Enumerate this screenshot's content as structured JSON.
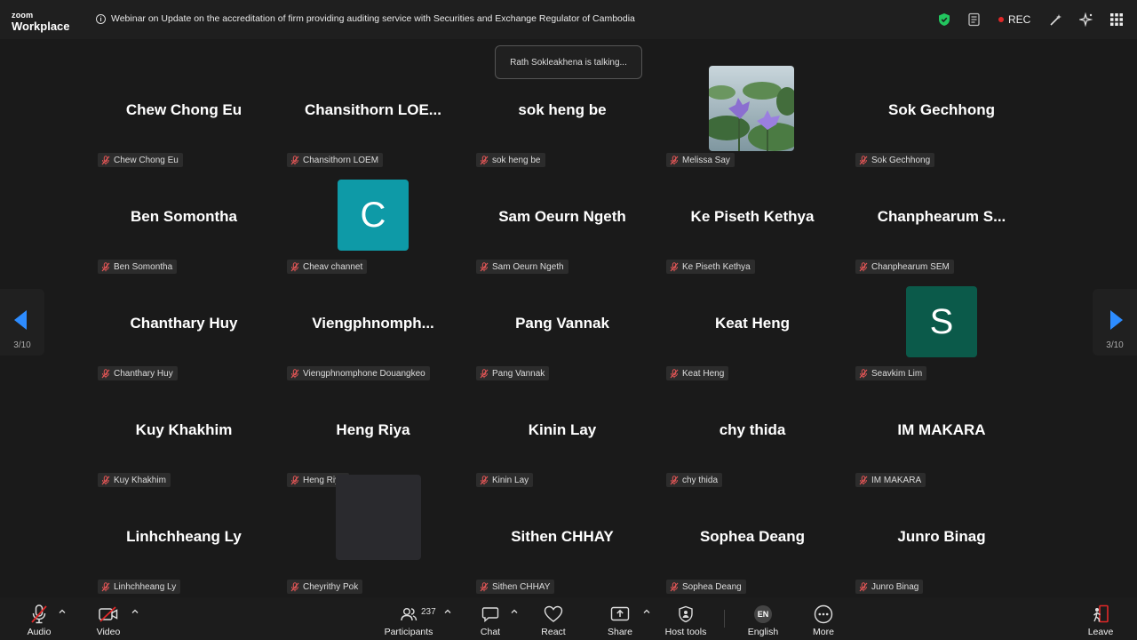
{
  "app": {
    "logo_top": "zoom",
    "logo_bottom": "Workplace"
  },
  "meeting": {
    "title": "Webinar on Update on the accreditation of firm providing auditing service with Securities and Exchange Regulator of Cambodia"
  },
  "top_right": {
    "rec_label": "REC",
    "rec_color": "#e02828",
    "shield_color": "#22c55e"
  },
  "talking_banner": "Rath Sokleakhena is talking...",
  "pagination": {
    "left_label": "3/10",
    "right_label": "3/10"
  },
  "participants": [
    {
      "display": "Chew Chong Eu",
      "tag": "Chew Chong Eu"
    },
    {
      "display": "Chansithorn  LOE...",
      "tag": "Chansithorn LOEM"
    },
    {
      "display": "sok heng be",
      "tag": "sok heng be"
    },
    {
      "display": "",
      "tag": "Melissa Say",
      "media": "photo-water-lilies"
    },
    {
      "display": "Sok Gechhong",
      "tag": "Sok Gechhong"
    },
    {
      "display": "Ben Somontha",
      "tag": "Ben Somontha"
    },
    {
      "display": "",
      "tag": "Cheav channet",
      "avatar_letter": "C",
      "avatar_color": "#0e9aa7"
    },
    {
      "display": "Sam Oeurn Ngeth",
      "tag": "Sam Oeurn Ngeth"
    },
    {
      "display": "Ke Piseth Kethya",
      "tag": "Ke Piseth Kethya"
    },
    {
      "display": "Chanphearum  S...",
      "tag": "Chanphearum SEM"
    },
    {
      "display": "Chanthary Huy",
      "tag": "Chanthary Huy"
    },
    {
      "display": "Viengphnomph...",
      "tag": "Viengphnomphone Douangkeo"
    },
    {
      "display": "Pang Vannak",
      "tag": "Pang Vannak"
    },
    {
      "display": "Keat Heng",
      "tag": "Keat Heng"
    },
    {
      "display": "",
      "tag": "Seavkim Lim",
      "avatar_letter": "S",
      "avatar_color": "#0b5a4a"
    },
    {
      "display": "Kuy Khakhim",
      "tag": "Kuy Khakhim"
    },
    {
      "display": "Heng Riya",
      "tag": "Heng Riya"
    },
    {
      "display": "Kinin Lay",
      "tag": "Kinin Lay"
    },
    {
      "display": "chy thida",
      "tag": "chy thida"
    },
    {
      "display": "IM MAKARA",
      "tag": "IM MAKARA"
    },
    {
      "display": "Linhchheang Ly",
      "tag": "Linhchheang Ly"
    },
    {
      "display": "",
      "tag": "Cheyrithy Pok",
      "media": "blank-video"
    },
    {
      "display": "Sithen CHHAY",
      "tag": "Sithen CHHAY"
    },
    {
      "display": "Sophea Deang",
      "tag": "Sophea Deang"
    },
    {
      "display": "Junro Binag",
      "tag": "Junro Binag"
    }
  ],
  "toolbar": {
    "audio": "Audio",
    "video": "Video",
    "participants": "Participants",
    "participants_count": "237",
    "chat": "Chat",
    "react": "React",
    "share": "Share",
    "host_tools": "Host tools",
    "language_badge": "EN",
    "language": "English",
    "more": "More",
    "leave": "Leave",
    "leave_color": "#e02828"
  }
}
